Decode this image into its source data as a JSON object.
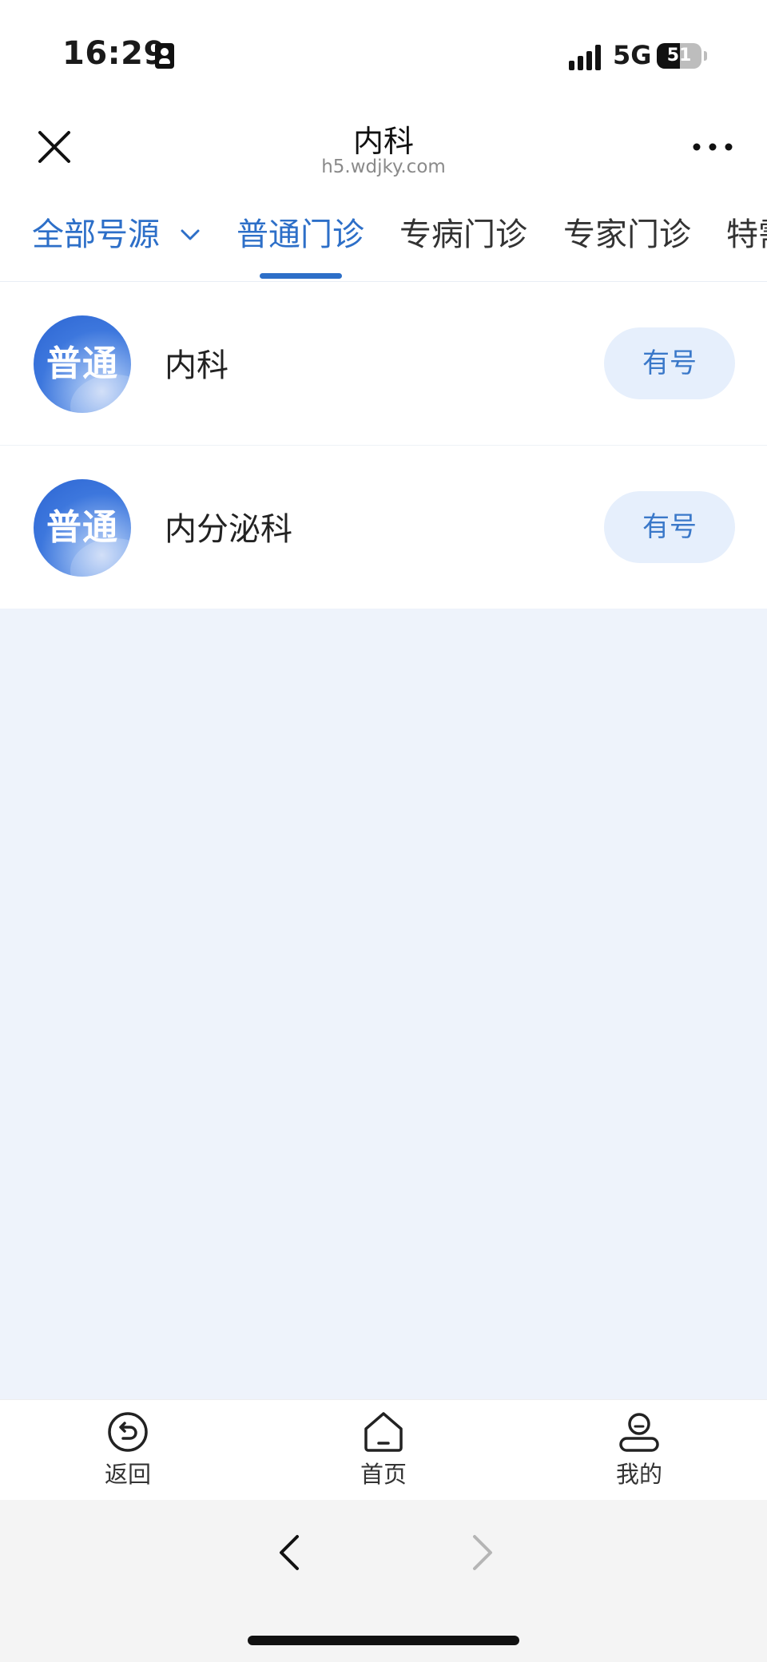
{
  "status_bar": {
    "time": "16:29",
    "network": "5G",
    "battery": "51",
    "battery_level": 0.51
  },
  "header": {
    "title": "内科",
    "subtitle": "h5.wdjky.com"
  },
  "tabs": {
    "filter_label": "全部号源",
    "items": [
      {
        "label": "普通门诊",
        "active": true
      },
      {
        "label": "专病门诊",
        "active": false
      },
      {
        "label": "专家门诊",
        "active": false
      },
      {
        "label": "特需",
        "active": false
      }
    ]
  },
  "departments": [
    {
      "badge": "普通",
      "name": "内科",
      "status": "有号"
    },
    {
      "badge": "普通",
      "name": "内分泌科",
      "status": "有号"
    }
  ],
  "bottom_nav": {
    "items": [
      {
        "label": "返回",
        "icon": "back-icon"
      },
      {
        "label": "首页",
        "icon": "home-icon"
      },
      {
        "label": "我的",
        "icon": "user-icon"
      }
    ]
  },
  "colors": {
    "accent": "#2d6fc8",
    "button_bg": "#e6effc",
    "empty_bg": "#eef3fb"
  }
}
